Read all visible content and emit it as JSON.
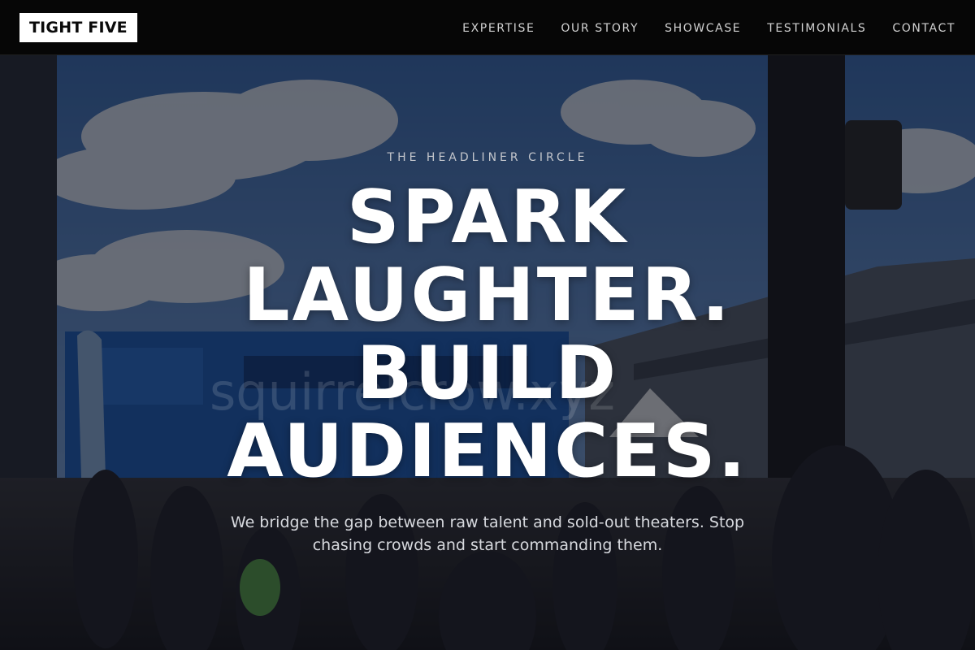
{
  "nav": {
    "logo": "TIGHT FIVE",
    "links": [
      "EXPERTISE",
      "OUR STORY",
      "SHOWCASE",
      "TESTIMONIALS",
      "CONTACT"
    ]
  },
  "hero": {
    "eyebrow": "THE HEADLINER CIRCLE",
    "headline_lines": [
      "SPARK",
      "LAUGHTER.",
      "BUILD",
      "AUDIENCES."
    ],
    "subtitle": "We bridge the gap between raw talent and sold-out theaters. Stop chasing crowds and start commanding them.",
    "watermark": "squirrelcrow.xyz"
  },
  "colors": {
    "nav_background": "#060606",
    "logo_background": "#ffffff",
    "headline": "#ffffff",
    "accent_truck_blue": "#1f5fb8"
  }
}
